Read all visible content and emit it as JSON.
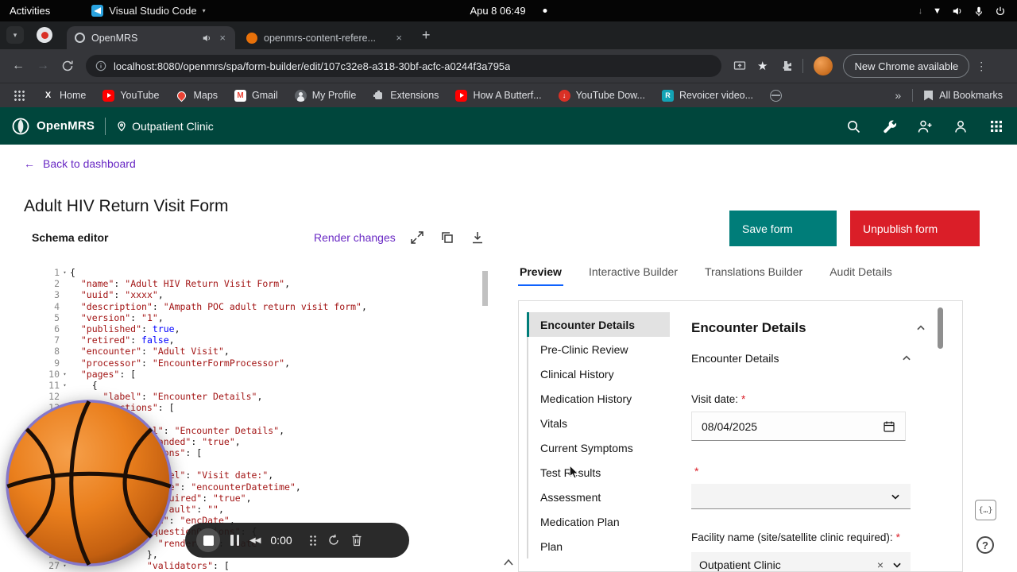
{
  "colors": {
    "brand": "#007d79",
    "danger": "#da1e28",
    "link": "#6929c4",
    "header": "#00463c"
  },
  "system_bar": {
    "activities": "Activities",
    "app_menu": "Visual Studio Code",
    "clock": "Apu 8 06:49"
  },
  "browser": {
    "tabs": [
      {
        "title": "OpenMRS",
        "audio": true
      },
      {
        "title": "openmrs-content-refere...",
        "audio": false
      }
    ],
    "url": "localhost:8080/openmrs/spa/form-builder/edit/107c32e8-a318-30bf-acfc-a0244f3a795a",
    "update_chip": "New Chrome available",
    "bookmarks": [
      {
        "label": "Home",
        "icon": "x"
      },
      {
        "label": "YouTube",
        "icon": "youtube"
      },
      {
        "label": "Maps",
        "icon": "maps"
      },
      {
        "label": "Gmail",
        "icon": "gmail"
      },
      {
        "label": "My Profile",
        "icon": "profile"
      },
      {
        "label": "Extensions",
        "icon": "extensions"
      },
      {
        "label": "How A Butterf...",
        "icon": "youtube"
      },
      {
        "label": "YouTube Dow...",
        "icon": "download"
      },
      {
        "label": "Revoicer video...",
        "icon": "revoicer"
      },
      {
        "label": "",
        "icon": "globe"
      }
    ],
    "all_bookmarks": "All Bookmarks"
  },
  "app_header": {
    "brand": "OpenMRS",
    "location": "Outpatient Clinic"
  },
  "page": {
    "back_link": "Back to dashboard",
    "title": "Adult HIV Return Visit Form",
    "schema_editor": "Schema editor",
    "render_changes": "Render changes",
    "save": "Save form",
    "unpublish": "Unpublish form"
  },
  "editor": {
    "lines": [
      "{",
      "  \"name\": \"Adult HIV Return Visit Form\",",
      "  \"uuid\": \"xxxx\",",
      "  \"description\": \"Ampath POC adult return visit form\",",
      "  \"version\": \"1\",",
      "  \"published\": true,",
      "  \"retired\": false,",
      "  \"encounter\": \"Adult Visit\",",
      "  \"processor\": \"EncounterFormProcessor\",",
      "  \"pages\": [",
      "    {",
      "      \"label\": \"Encounter Details\",",
      "      \"sections\": [",
      "        {",
      "          \"label\": \"Encounter Details\",",
      "          \"isExpanded\": \"true\",",
      "          \"questions\": [",
      "            {",
      "              \"label\": \"Visit date:\",",
      "              \"type\": \"encounterDatetime\",",
      "              \"required\": \"true\",",
      "              \"default\": \"\",",
      "              \"id\": \"encDate\",",
      "              \"questionOptions\": {",
      "                \"rendering\": \"date\"",
      "              },",
      "              \"validators\": ["
    ]
  },
  "panel": {
    "tabs": [
      "Preview",
      "Interactive Builder",
      "Translations Builder",
      "Audit Details"
    ],
    "active_tab": "Preview"
  },
  "preview": {
    "nav": [
      "Encounter Details",
      "Pre-Clinic Review",
      "Clinical History",
      "Medication History",
      "Vitals",
      "Current Symptoms",
      "Test Results",
      "Assessment",
      "Medication Plan",
      "Plan"
    ],
    "selected_nav": "Encounter Details",
    "heading": "Encounter Details",
    "subheading": "Encounter Details",
    "visit_date": {
      "label": "Visit date:",
      "required": "*",
      "value": "08/04/2025"
    },
    "unlabeled_required": "*",
    "facility": {
      "label": "Facility name (site/satellite clinic required):",
      "required": "*",
      "value": "Outpatient Clinic"
    }
  },
  "recorder": {
    "time": "0:00"
  }
}
